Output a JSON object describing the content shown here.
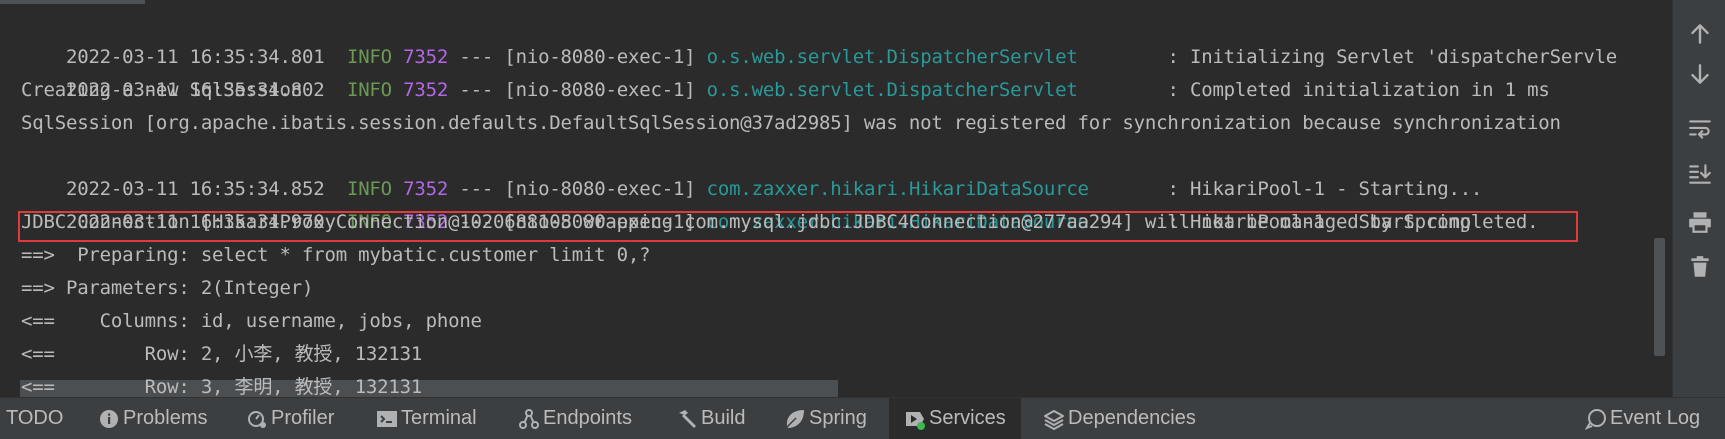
{
  "console": {
    "lines": [
      {
        "ts": "2022-03-11 16:35:34.801",
        "level": "INFO",
        "pid": "7352",
        "sep": "---",
        "thread": "[nio-8080-exec-1]",
        "logger": "o.s.web.servlet.DispatcherServlet",
        "msg": ": Initializing Servlet 'dispatcherServle"
      },
      {
        "ts": "2022-03-11 16:35:34.802",
        "level": "INFO",
        "pid": "7352",
        "sep": "---",
        "thread": "[nio-8080-exec-1]",
        "logger": "o.s.web.servlet.DispatcherServlet",
        "msg": ": Completed initialization in 1 ms"
      },
      {
        "text": "Creating a new SqlSession"
      },
      {
        "text": "SqlSession [org.apache.ibatis.session.defaults.DefaultSqlSession@37ad2985] was not registered for synchronization because synchronization"
      },
      {
        "ts": "2022-03-11 16:35:34.852",
        "level": "INFO",
        "pid": "7352",
        "sep": "---",
        "thread": "[nio-8080-exec-1]",
        "logger": "com.zaxxer.hikari.HikariDataSource",
        "msg": ": HikariPool-1 - Starting..."
      },
      {
        "ts": "2022-03-11 16:35:34.970",
        "level": "INFO",
        "pid": "7352",
        "sep": "---",
        "thread": "[nio-8080-exec-1]",
        "logger": "com.zaxxer.hikari.HikariDataSource",
        "msg": ": HikariPool-1 - Start completed."
      },
      {
        "text": "JDBC Connection [HikariProxyConnection@1020688105 wrapping com.mysql.jdbc.JDBC4Connection@277aa294] will not be managed by Spring"
      },
      {
        "text": "==>  Preparing: select * from mybatic.customer limit 0,?"
      },
      {
        "text": "==> Parameters: 2(Integer)"
      },
      {
        "text": "<==    Columns: id, username, jobs, phone"
      },
      {
        "text": "<==        Row: 2, 小李, 教授, 132131"
      },
      {
        "text": "<==        Row: 3, 李明, 教授, 132131"
      }
    ]
  },
  "toolbar": {
    "items": [
      {
        "icon": "arrow-up-icon"
      },
      {
        "icon": "arrow-down-icon"
      },
      {
        "icon": "soft-wrap-icon"
      },
      {
        "icon": "scroll-to-end-icon"
      },
      {
        "icon": "print-icon"
      },
      {
        "icon": "trash-icon"
      }
    ]
  },
  "bottom_tabs": {
    "todo": "TODO",
    "problems": "Problems",
    "profiler": "Profiler",
    "terminal": "Terminal",
    "endpoints": "Endpoints",
    "build": "Build",
    "spring": "Spring",
    "services": "Services",
    "dependencies": "Dependencies",
    "event_log": "Event Log",
    "active": "Services"
  },
  "colors": {
    "background": "#2b2b2b",
    "info_level": "#6a9955",
    "pid": "#b267e6",
    "logger": "#299999",
    "highlight_border": "#e03a3a",
    "services_status": "#3fb950"
  }
}
